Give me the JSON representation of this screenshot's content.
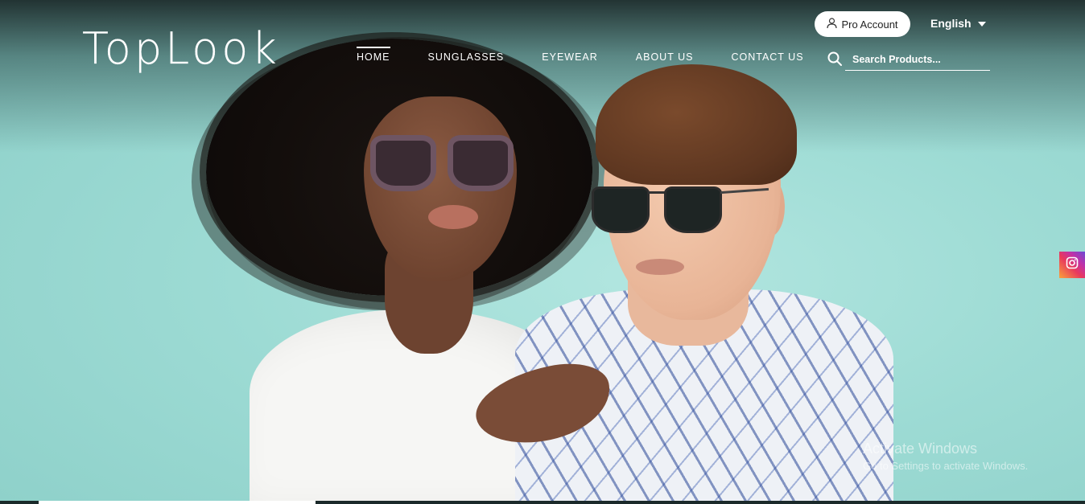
{
  "brand": {
    "logo_text": "TopLook"
  },
  "nav": {
    "items": [
      {
        "label": "HOME",
        "active": true
      },
      {
        "label": "SUNGLASSES",
        "active": false
      },
      {
        "label": "EYEWEAR",
        "active": false
      },
      {
        "label": "ABOUT US",
        "active": false
      },
      {
        "label": "CONTACT US",
        "active": false
      }
    ]
  },
  "header": {
    "pro_account_label": "Pro Account",
    "language": "English"
  },
  "search": {
    "placeholder": "Search Products..."
  },
  "social": {
    "icon": "instagram-icon"
  },
  "watermark": {
    "title": "Activate Windows",
    "subtitle": "Go to Settings to activate Windows."
  },
  "colors": {
    "background": "#9fdcd6",
    "header_overlay": "#1f3030",
    "text": "#ffffff"
  }
}
